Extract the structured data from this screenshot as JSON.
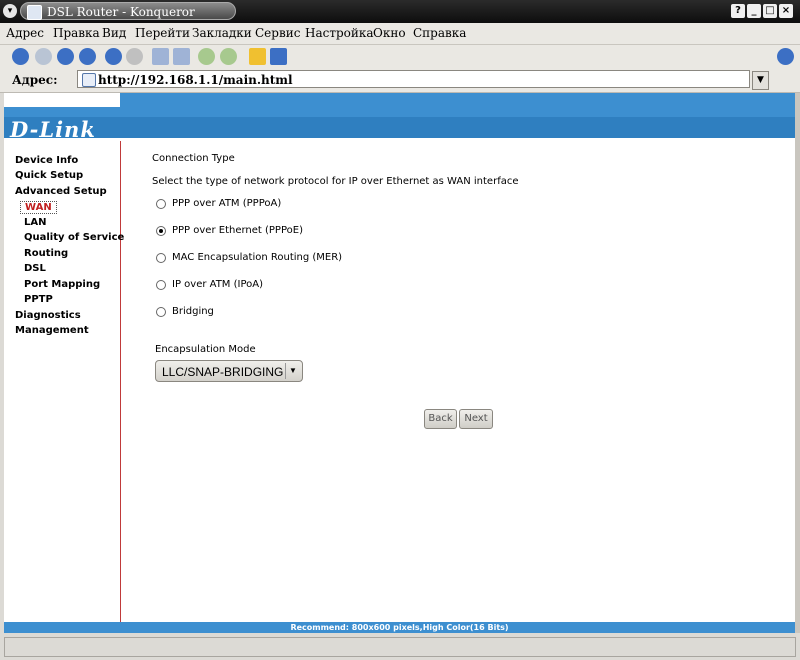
{
  "window": {
    "title": "DSL Router - Konqueror",
    "title_buttons": [
      "?",
      "_",
      "□",
      "×"
    ]
  },
  "menubar": {
    "items": [
      "Адрес",
      "Правка",
      "Вид",
      "Перейти",
      "Закладки",
      "Сервис",
      "Настройка",
      "Окно",
      "Справка"
    ]
  },
  "locationbar": {
    "label": "Адрес:",
    "url": "http://192.168.1.1/main.html"
  },
  "brand": {
    "logo": "D-Link",
    "blue": "#3d8fd0"
  },
  "nav": {
    "items": [
      "Device Info",
      "Quick Setup",
      "Advanced Setup",
      "WAN",
      "LAN",
      "Quality of Service",
      "Routing",
      "DSL",
      "Port Mapping",
      "PPTP",
      "Diagnostics",
      "Management"
    ],
    "selected": "WAN"
  },
  "main": {
    "heading": "Connection Type",
    "description": "Select the type of network protocol for IP over Ethernet as WAN interface",
    "options": [
      {
        "label": "PPP over ATM (PPPoA)",
        "checked": false
      },
      {
        "label": "PPP over Ethernet (PPPoE)",
        "checked": true
      },
      {
        "label": "MAC Encapsulation Routing (MER)",
        "checked": false
      },
      {
        "label": "IP over ATM (IPoA)",
        "checked": false
      },
      {
        "label": "Bridging",
        "checked": false
      }
    ],
    "encapsulation_label": "Encapsulation Mode",
    "encapsulation_value": "LLC/SNAP-BRIDGING",
    "back_label": "Back",
    "next_label": "Next"
  },
  "footer": {
    "text": "Recommend: 800x600 pixels,High Color(16 Bits)"
  }
}
